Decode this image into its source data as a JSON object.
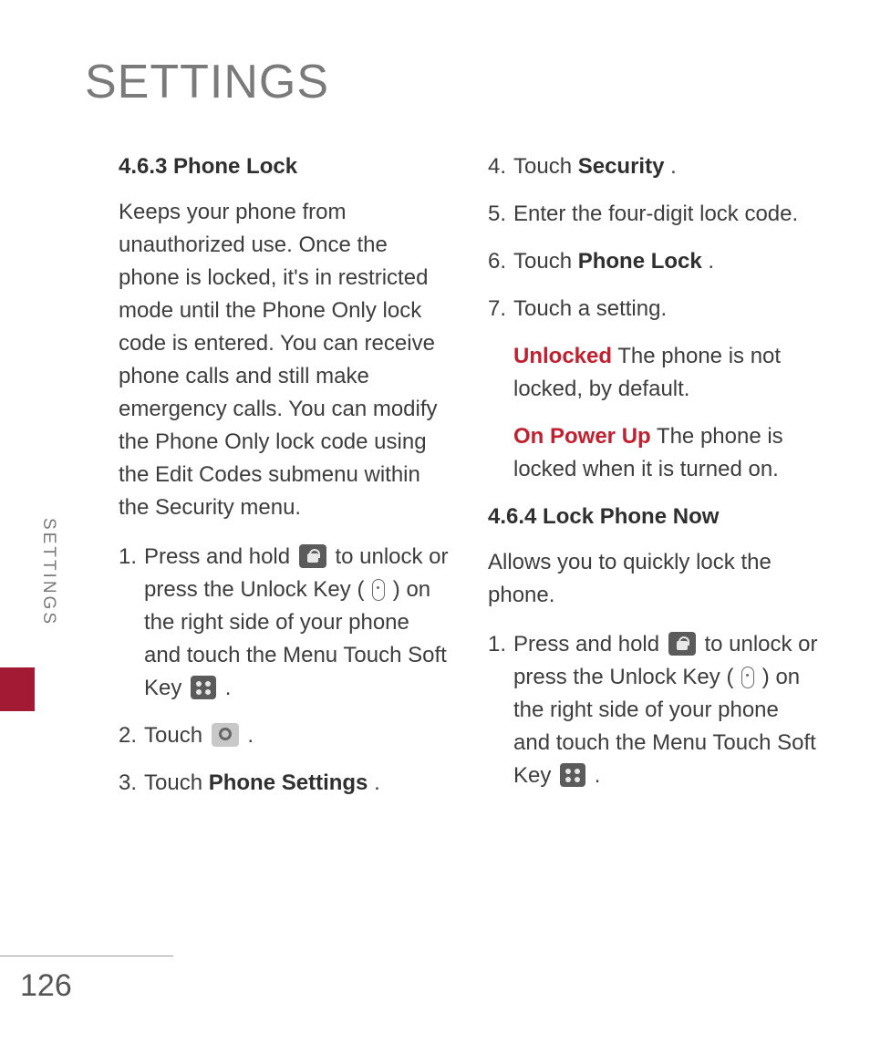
{
  "page_title": "SETTINGS",
  "side_tab": "SETTINGS",
  "page_number": "126",
  "left": {
    "heading": "4.6.3 Phone Lock",
    "intro": "Keeps your phone from unauthorized use. Once the phone is locked, it's in restricted mode until the Phone Only lock code is entered. You can receive phone calls and still make emergency calls. You can modify the Phone Only lock code using the Edit Codes submenu within the Security menu.",
    "step1_num": "1.",
    "step1_a": "Press and hold ",
    "step1_b": " to unlock or press the Unlock Key ( ",
    "step1_c": " ) on the right side of your phone and touch the Menu Touch Soft Key ",
    "step1_d": " .",
    "step2_num": "2.",
    "step2_a": "Touch ",
    "step2_b": ".",
    "step3_num": "3.",
    "step3_a": "Touch ",
    "step3_bold": "Phone Settings",
    "step3_b": "."
  },
  "right": {
    "step4_num": "4.",
    "step4_a": "Touch ",
    "step4_bold": "Security",
    "step4_b": ".",
    "step5_num": "5.",
    "step5": "Enter the four-digit lock code.",
    "step6_num": "6.",
    "step6_a": "Touch ",
    "step6_bold": "Phone Lock",
    "step6_b": ".",
    "step7_num": "7.",
    "step7": "Touch a setting.",
    "opt1_label": "Unlocked",
    "opt1_desc": "  The phone is not locked, by default.",
    "opt2_label": "On Power Up",
    "opt2_desc": "  The phone is locked when  it is turned on.",
    "heading2": "4.6.4 Lock Phone Now",
    "intro2": "Allows you to quickly lock the phone.",
    "b_step1_num": "1.",
    "b_step1_a": "Press and hold ",
    "b_step1_b": " to unlock or press the Unlock Key ( ",
    "b_step1_c": " ) on the right side of your phone and touch the Menu Touch Soft Key ",
    "b_step1_d": " ."
  }
}
